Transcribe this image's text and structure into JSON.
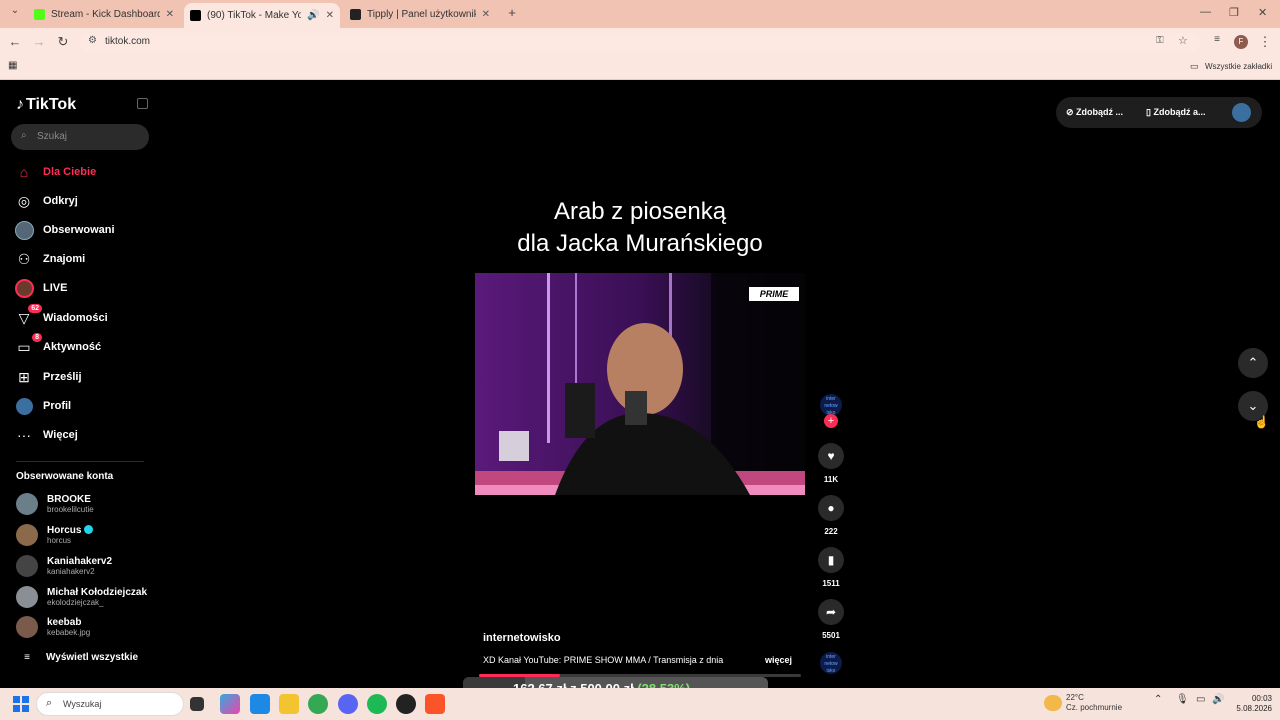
{
  "browser": {
    "tabs": [
      {
        "title": "Stream - Kick Dashboard",
        "favicon_color": "#53fc18"
      },
      {
        "title": "(90) TikTok - Make Your Day",
        "favicon_color": "#000000"
      },
      {
        "title": "Tipply | Panel użytkownika",
        "favicon_color": "#222222"
      }
    ],
    "url": "tiktok.com",
    "bookmarks_label": "Wszystkie zakładki"
  },
  "sidebar": {
    "logo": "TikTok",
    "search_placeholder": "Szukaj",
    "items": [
      {
        "label": "Dla Ciebie",
        "icon": "home-icon",
        "active": true
      },
      {
        "label": "Odkryj",
        "icon": "compass-icon"
      },
      {
        "label": "Obserwowani",
        "icon": "avatar-icon"
      },
      {
        "label": "Znajomi",
        "icon": "friends-icon"
      },
      {
        "label": "LIVE",
        "icon": "live-icon"
      },
      {
        "label": "Wiadomości",
        "icon": "messages-icon",
        "badge": "62"
      },
      {
        "label": "Aktywność",
        "icon": "activity-icon",
        "badge": "8"
      },
      {
        "label": "Prześlij",
        "icon": "upload-icon"
      },
      {
        "label": "Profil",
        "icon": "profile-icon"
      },
      {
        "label": "Więcej",
        "icon": "more-icon"
      }
    ],
    "followed_title": "Obserwowane konta",
    "accounts": [
      {
        "name": "BROOKE",
        "handle": "brookelilcutie"
      },
      {
        "name": "Horcus",
        "handle": "horcus",
        "verified": true
      },
      {
        "name": "Kaniahakerv2",
        "handle": "kaniahakerv2"
      },
      {
        "name": "Michał Kołodziejczak",
        "handle": "ekolodziejczak_"
      },
      {
        "name": "keebab",
        "handle": "kebabek.jpg"
      }
    ],
    "show_all": "Wyświetl wszystkie"
  },
  "video": {
    "title_line1": "Arab z piosenką",
    "title_line2": "dla Jacka Murańskiego",
    "brand_logo": "PRIME",
    "author": "internetowisko",
    "description": "XD Kanał YouTube: PRIME SHOW MMA / Transmisja z dnia",
    "more": "więcej",
    "progress": 0.25,
    "creator_avatar_text": "inter netow isko",
    "likes": "11K",
    "comments": "222",
    "saves": "1511",
    "shares": "5501"
  },
  "top_bar": {
    "btn1": "Zdobądź ...",
    "btn2": "Zdobądź a..."
  },
  "overlay": {
    "text_main": "162,67 zł z 500,00 zł",
    "text_pct": "(28.53%)"
  },
  "taskbar": {
    "search_placeholder": "Wyszukaj",
    "weather_temp": "22°C",
    "weather_desc": "Cz. pochmurnie",
    "time": "00:03",
    "date": "5.08.2026"
  }
}
